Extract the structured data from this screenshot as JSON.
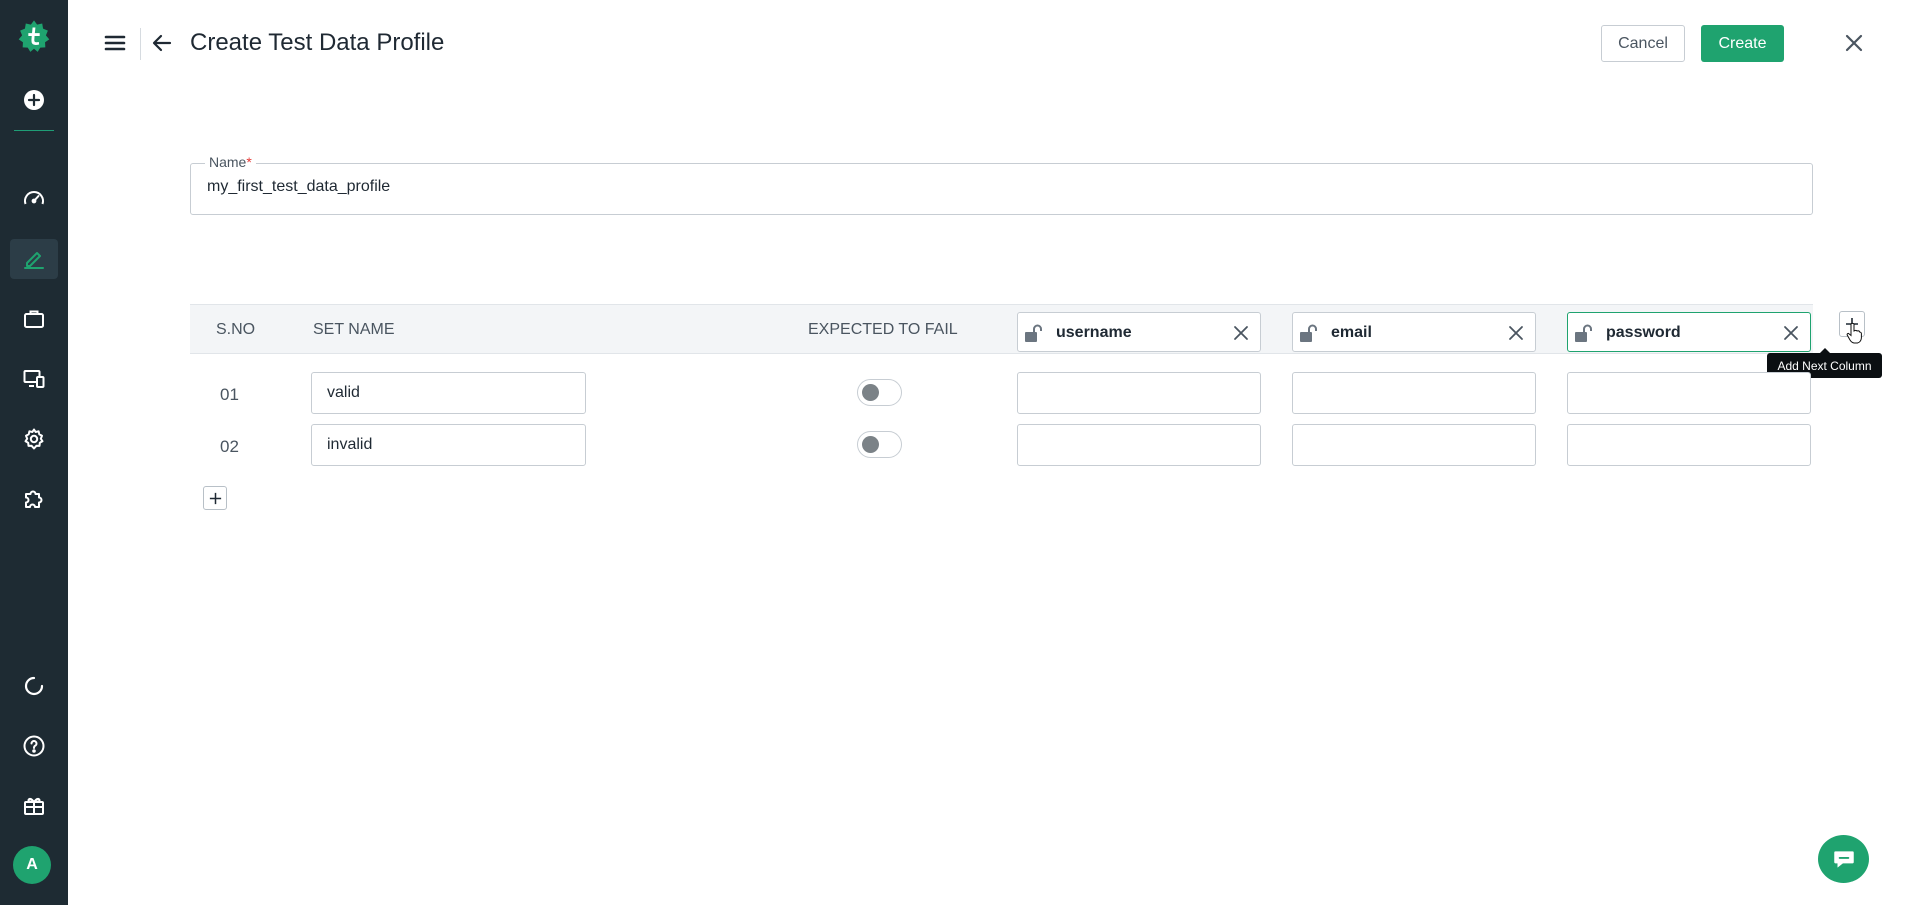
{
  "header": {
    "title": "Create Test Data Profile",
    "cancel_label": "Cancel",
    "create_label": "Create"
  },
  "form": {
    "name_label": "Name",
    "name_required_mark": "*",
    "name_value": "my_first_test_data_profile"
  },
  "table": {
    "headers": {
      "sno": "S.NO",
      "set_name": "SET NAME",
      "expected_to_fail": "EXPECTED TO FAIL"
    },
    "columns": [
      "username",
      "email",
      "password"
    ],
    "rows": [
      {
        "no": "01",
        "set_name": "valid",
        "expected_to_fail": false
      },
      {
        "no": "02",
        "set_name": "invalid",
        "expected_to_fail": false
      }
    ],
    "add_column_tooltip": "Add Next Column"
  },
  "sidebar": {
    "avatar_initial": "A",
    "icons": [
      "logo-icon",
      "add-circle-icon",
      "dashboard-icon",
      "edit-icon",
      "briefcase-icon",
      "devices-icon",
      "settings-icon",
      "puzzle-icon",
      "sync-icon",
      "help-icon",
      "gift-icon"
    ]
  },
  "colors": {
    "sidebar_bg": "#1e2b33",
    "accent": "#1fa36f"
  }
}
